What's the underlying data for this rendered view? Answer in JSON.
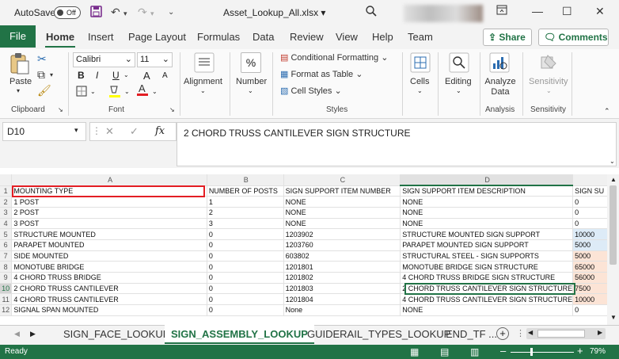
{
  "titlebar": {
    "autosave_label": "AutoSave",
    "autosave_state": "Off",
    "doc_title": "Asset_Lookup_All.xlsx",
    "doc_title_caret": "▾",
    "save_icon": "save-icon",
    "undo_icon": "undo-icon",
    "redo_icon": "redo-icon"
  },
  "tabs": [
    "File",
    "Home",
    "Insert",
    "Page Layout",
    "Formulas",
    "Data",
    "Review",
    "View",
    "Help",
    "Team"
  ],
  "share_label": "Share",
  "comments_label": "Comments",
  "ribbon": {
    "paste": "Paste",
    "clipboard": "Clipboard",
    "font_name": "Calibri",
    "font_size": "11",
    "font_group": "Font",
    "alignment": "Alignment",
    "number": "Number",
    "percent": "%",
    "conditional_formatting": "Conditional Formatting",
    "format_as_table": "Format as Table",
    "cell_styles": "Cell Styles",
    "styles_group": "Styles",
    "cells": "Cells",
    "editing": "Editing",
    "analyze_data": "Analyze Data",
    "analysis_group": "Analysis",
    "sensitivity": "Sensitivity",
    "sensitivity_group": "Sensitivity",
    "bold": "B",
    "italic": "I",
    "underline": "U",
    "grow_font": "A",
    "shrink_font": "A"
  },
  "formula_bar": {
    "name_box": "D10",
    "fx": "fx",
    "content": "2 CHORD TRUSS CANTILEVER SIGN STRUCTURE"
  },
  "sheet": {
    "columns": [
      "A",
      "B",
      "C",
      "D"
    ],
    "rows": [
      {
        "n": "1",
        "a": "MOUNTING TYPE",
        "b": "NUMBER OF POSTS",
        "c": "SIGN SUPPORT ITEM NUMBER",
        "d": "SIGN SUPPORT ITEM DESCRIPTION",
        "e": "SIGN SU"
      },
      {
        "n": "2",
        "a": "1 POST",
        "b": "1",
        "c": "NONE",
        "d": "NONE",
        "e": "0"
      },
      {
        "n": "3",
        "a": "2 POST",
        "b": "2",
        "c": "NONE",
        "d": "NONE",
        "e": "0"
      },
      {
        "n": "4",
        "a": "3 POST",
        "b": "3",
        "c": "NONE",
        "d": "NONE",
        "e": "0"
      },
      {
        "n": "5",
        "a": "STRUCTURE MOUNTED",
        "b": "0",
        "c": "1203902",
        "d": "STRUCTURE MOUNTED SIGN SUPPORT",
        "e": "10000"
      },
      {
        "n": "6",
        "a": "PARAPET MOUNTED",
        "b": "0",
        "c": "1203760",
        "d": "PARAPET MOUNTED SIGN SUPPORT",
        "e": "5000"
      },
      {
        "n": "7",
        "a": "SIDE MOUNTED",
        "b": "0",
        "c": "603802",
        "d": "STRUCTURAL STEEL - SIGN SUPPORTS",
        "e": "5000"
      },
      {
        "n": "8",
        "a": "MONOTUBE BRIDGE",
        "b": "0",
        "c": "1201801",
        "d": "MONOTUBE BRIDGE SIGN STRUCTURE",
        "e": "65000"
      },
      {
        "n": "9",
        "a": "4 CHORD TRUSS BRIDGE",
        "b": "0",
        "c": "1201802",
        "d": "4 CHORD TRUSS BRIDGE SIGN STRUCTURE",
        "e": "56000"
      },
      {
        "n": "10",
        "a": "2 CHORD TRUSS CANTILEVER",
        "b": "0",
        "c": "1201803",
        "d": "2 CHORD TRUSS CANTILEVER SIGN STRUCTURE",
        "e": "7500"
      },
      {
        "n": "11",
        "a": "4 CHORD TRUSS CANTILEVER",
        "b": "0",
        "c": "1201804",
        "d": "4 CHORD TRUSS CANTILEVER SIGN STRUCTURE",
        "e": "10000"
      },
      {
        "n": "12",
        "a": "SIGNAL SPAN MOUNTED",
        "b": "0",
        "c": "None",
        "d": "NONE",
        "e": "0"
      }
    ],
    "colors": {
      "blue": "#ddebf7",
      "orange": "#fce4d6",
      "accent": "#217346",
      "highlight": "#e31e24"
    }
  },
  "sheet_tabs": [
    "SIGN_FACE_LOOKUP",
    "SIGN_ASSEMBLY_LOOKUP",
    "GUIDERAIL_TYPES_LOOKUP",
    "END_TF ..."
  ],
  "status": {
    "ready": "Ready",
    "zoom": "79%"
  }
}
